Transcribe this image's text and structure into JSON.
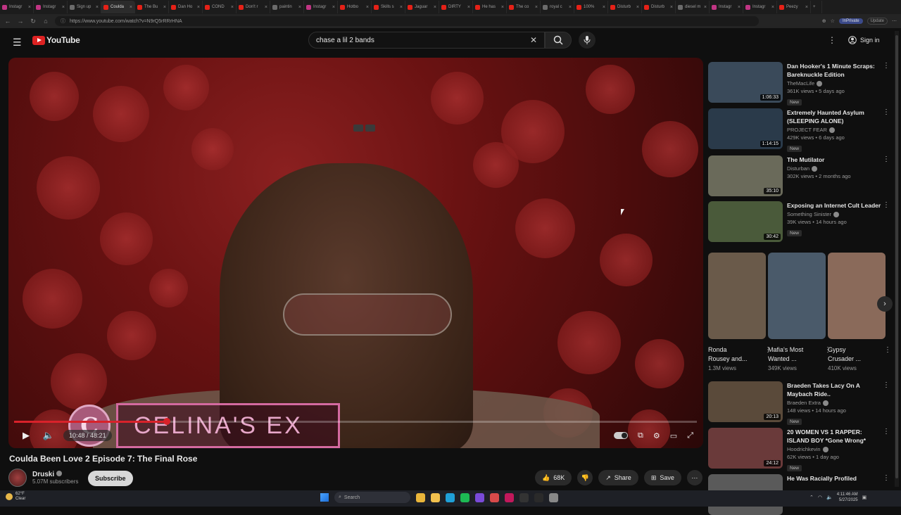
{
  "browser": {
    "tabs": [
      {
        "label": "Instagr",
        "color": "#c13584"
      },
      {
        "label": "Instagr",
        "color": "#c13584"
      },
      {
        "label": "Sign up",
        "color": "#6b6b6b"
      },
      {
        "label": "Coulda",
        "color": "#e62117",
        "active": true
      },
      {
        "label": "The Bu",
        "color": "#e62117"
      },
      {
        "label": "Dan Ho",
        "color": "#e62117"
      },
      {
        "label": "COND",
        "color": "#e62117"
      },
      {
        "label": "Don't r",
        "color": "#e62117"
      },
      {
        "label": "paintin",
        "color": "#6b6b6b"
      },
      {
        "label": "Instagr",
        "color": "#c13584"
      },
      {
        "label": "Hotbo",
        "color": "#e62117"
      },
      {
        "label": "Skills s",
        "color": "#e62117"
      },
      {
        "label": "Jaguar",
        "color": "#e62117"
      },
      {
        "label": "DIRTY",
        "color": "#e62117"
      },
      {
        "label": "He has",
        "color": "#e62117"
      },
      {
        "label": "The co",
        "color": "#e62117"
      },
      {
        "label": "royal c",
        "color": "#6b6b6b"
      },
      {
        "label": "100%",
        "color": "#e62117"
      },
      {
        "label": "Disturb",
        "color": "#e62117"
      },
      {
        "label": "Disturb",
        "color": "#e62117"
      },
      {
        "label": "diesel m",
        "color": "#6b6b6b"
      },
      {
        "label": "Instagr",
        "color": "#c13584"
      },
      {
        "label": "Instagr",
        "color": "#c13584"
      },
      {
        "label": "Peezy",
        "color": "#e62117"
      }
    ],
    "url": "https://www.youtube.com/watch?v=N9rQ5rRRrHNA",
    "profile_label": "InPrivate",
    "update_label": "Update"
  },
  "header": {
    "logo_text": "YouTube",
    "search_value": "chase a lil 2 bands",
    "signin_label": "Sign in"
  },
  "player": {
    "lower_third_text": "CELINA'S EX",
    "lower_third_letter": "C",
    "current_time": "10:48",
    "duration": "48:21",
    "progress_fraction": 0.2235
  },
  "video": {
    "title": "Coulda Been Love 2 Episode 7: The Final Rose",
    "channel": "Druski",
    "subscribers": "5.07M subscribers",
    "subscribe_label": "Subscribe",
    "likes": "68K",
    "share_label": "Share",
    "save_label": "Save"
  },
  "recommended": [
    {
      "title": "Dan Hooker's 1 Minute Scraps: Bareknuckle Edition",
      "channel": "TheMacLife",
      "meta": "361K views • 5 days ago",
      "duration": "1:06:33",
      "new": "New",
      "thumb": "#3a4a5a"
    },
    {
      "title": "Extremely Haunted Asylum (SLEEPING ALONE)",
      "channel": "PROJECT FEAR",
      "meta": "429K views • 6 days ago",
      "duration": "1:14:15",
      "new": "New",
      "thumb": "#2a3a4a"
    },
    {
      "title": "The Mutilator",
      "channel": "Disturban",
      "meta": "302K views • 2 months ago",
      "duration": "35:10",
      "new": "",
      "thumb": "#6a6a5a"
    },
    {
      "title": "Exposing an Internet Cult Leader",
      "channel": "Something Sinister",
      "meta": "39K views • 14 hours ago",
      "duration": "30:42",
      "new": "New",
      "thumb": "#4a5a3a"
    }
  ],
  "shorts": [
    {
      "title1": "Ronda",
      "title2": "Rousey and...",
      "views": "1.3M views",
      "thumb": "#6a5a4a"
    },
    {
      "title1": "Mafia's Most",
      "title2": "Wanted ...",
      "views": "349K views",
      "thumb": "#4a5a6a"
    },
    {
      "title1": "Gypsy",
      "title2": "Crusader ...",
      "views": "410K views",
      "thumb": "#8a6a5a"
    }
  ],
  "recommended_lower": [
    {
      "title": "Braeden Takes Lacy On A Maybach Ride..",
      "channel": "Braeden Extra",
      "meta": "148 views • 14 hours ago",
      "duration": "20:13",
      "new": "New",
      "thumb": "#5a4a3a"
    },
    {
      "title": "20 WOMEN VS 1 RAPPER: ISLAND BOY *Gone Wrong*",
      "channel": "Hoodrichkevin",
      "meta": "62K views • 1 day ago",
      "duration": "24:12",
      "new": "New",
      "thumb": "#6a3a3a"
    },
    {
      "title": "He Was Racially Profiled",
      "channel": "",
      "meta": "",
      "duration": "",
      "new": "",
      "thumb": "#5a5a5a"
    }
  ],
  "taskbar": {
    "temp": "62°F",
    "condition": "Clear",
    "search_label": "Search",
    "time": "4:11:46 AM",
    "date": "5/27/2025"
  }
}
